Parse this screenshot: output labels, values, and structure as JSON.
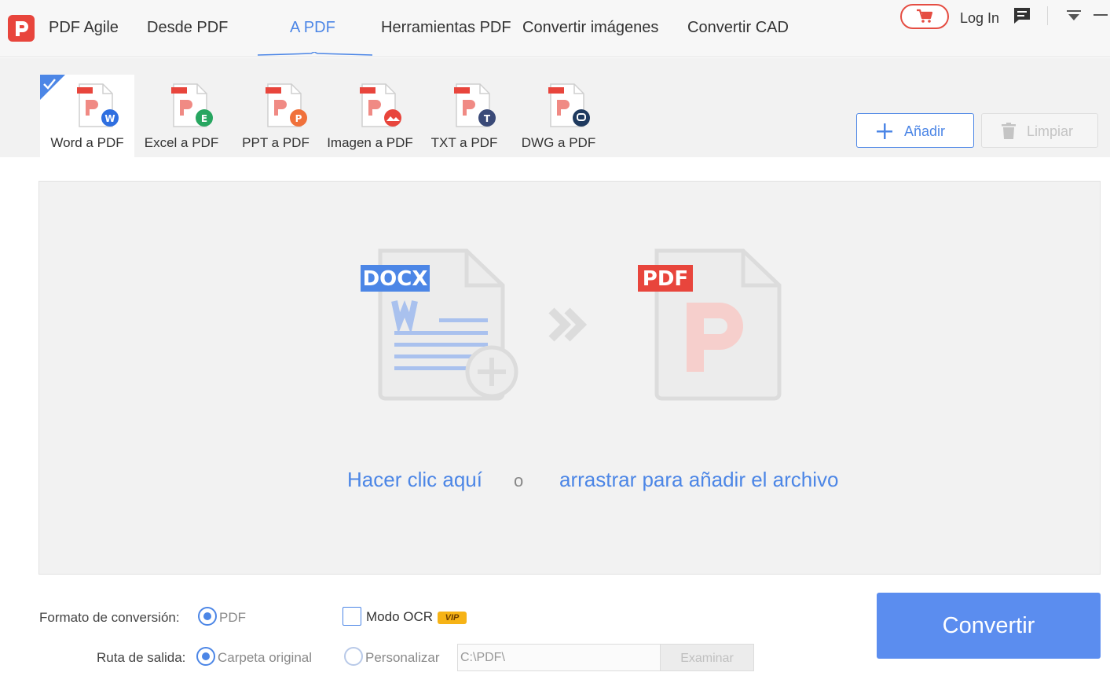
{
  "app": {
    "name": "PDF Agile"
  },
  "nav": {
    "tabs": [
      {
        "label": "Desde PDF"
      },
      {
        "label": "A PDF",
        "active": true
      },
      {
        "label": "Herramientas PDF"
      },
      {
        "label": "Convertir imágenes"
      },
      {
        "label": "Convertir CAD"
      }
    ],
    "login_label": "Log In"
  },
  "tools": [
    {
      "label": "Word a PDF",
      "badge_letter": "W",
      "badge_color": "#2f6fe0",
      "selected": true
    },
    {
      "label": "Excel a PDF",
      "badge_letter": "E",
      "badge_color": "#27a660"
    },
    {
      "label": "PPT a PDF",
      "badge_letter": "P",
      "badge_color": "#f0713b"
    },
    {
      "label": "Imagen a PDF",
      "badge_letter": "img",
      "badge_color": "#e8453c"
    },
    {
      "label": "TXT a PDF",
      "badge_letter": "T",
      "badge_color": "#3a4a78"
    },
    {
      "label": "DWG a PDF",
      "badge_letter": "D",
      "badge_color": "#1f3a5f"
    }
  ],
  "actions": {
    "add_label": "Añadir",
    "clear_label": "Limpiar"
  },
  "dropzone": {
    "source_tag": "DOCX",
    "target_tag": "PDF",
    "click_label": "Hacer clic aquí",
    "or_label": "o",
    "drag_label": "arrastrar para añadir el archivo"
  },
  "options": {
    "format_label": "Formato de conversión:",
    "format_value": "PDF",
    "ocr_label": "Modo OCR",
    "vip_badge": "VIP",
    "output_label": "Ruta de salida:",
    "output_original": "Carpeta original",
    "output_custom": "Personalizar",
    "path_value": "C:\\PDF\\",
    "browse_label": "Examinar"
  },
  "convert_label": "Convertir",
  "colors": {
    "accent": "#4c86e6",
    "brand_red": "#e8453c",
    "convert_blue": "#5b8def"
  }
}
